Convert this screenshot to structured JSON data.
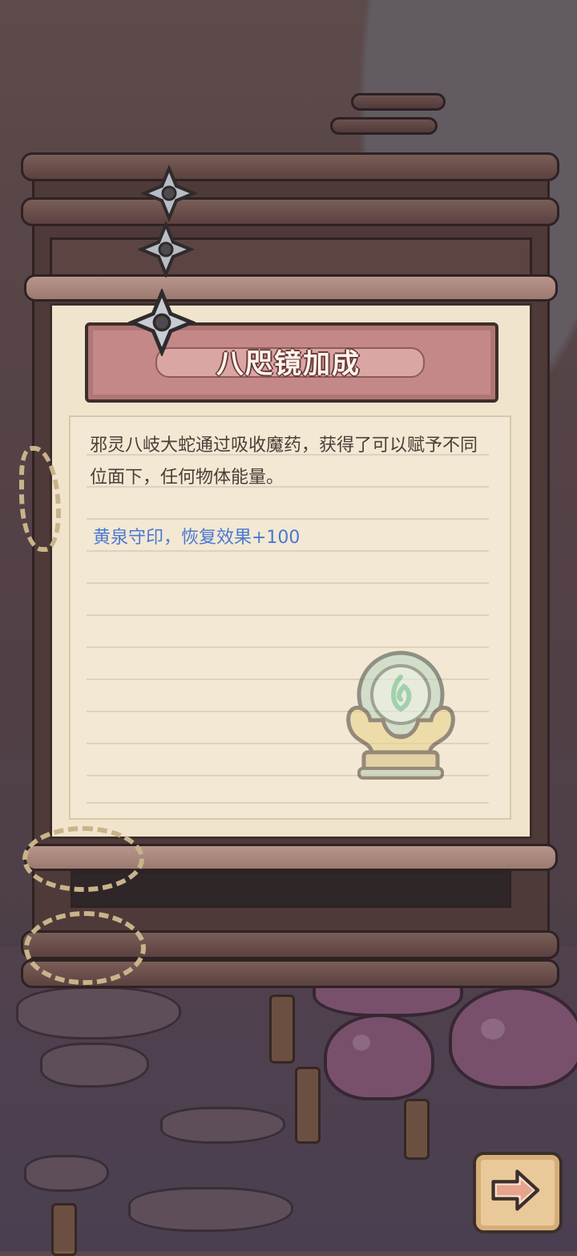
{
  "panel": {
    "title": "八咫镜加成",
    "description": "邪灵八岐大蛇通过吸收魔药，获得了可以赋予不同位面下，任何物体能量。",
    "bonus": "黄泉守印，恢复效果+100"
  },
  "icons": {
    "item": "mirror-artifact-icon",
    "decoration": "shuriken-icon",
    "next": "arrow-right-icon"
  },
  "colors": {
    "banner": "#c48888",
    "paper": "#f1e4cc",
    "bonus_text": "#4a78d4"
  }
}
